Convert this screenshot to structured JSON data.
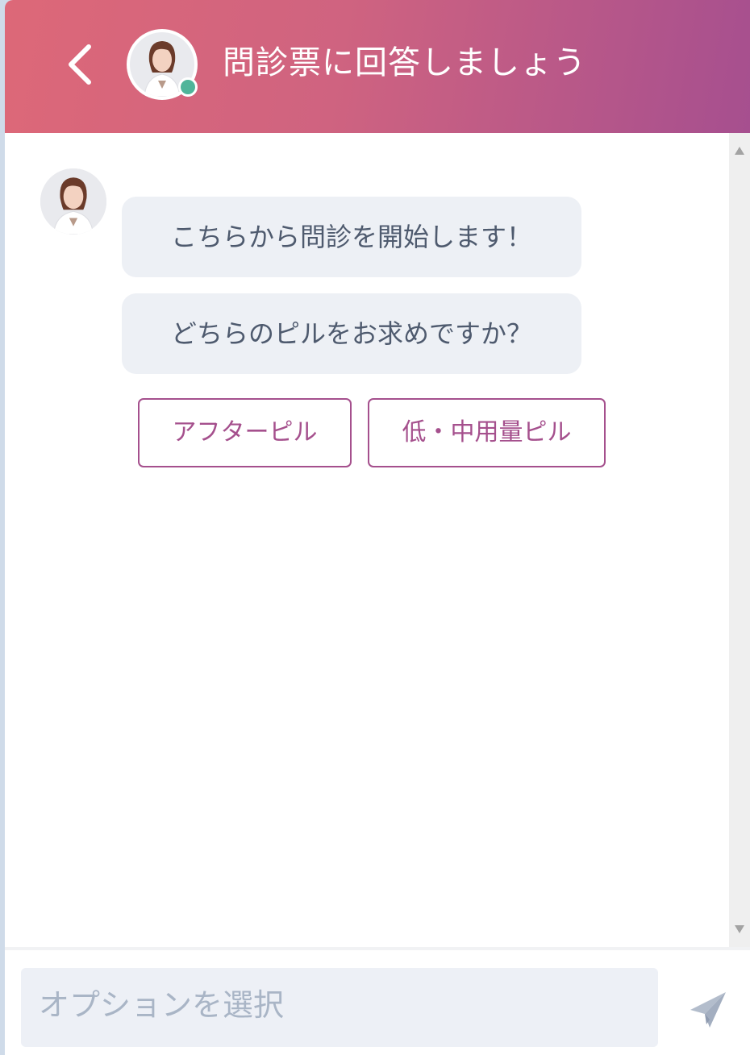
{
  "header": {
    "title": "問診票に回答しましょう",
    "gradient_start": "#dd6878",
    "gradient_end": "#a64f8f",
    "online_status_color": "#4fb59a"
  },
  "messages": [
    {
      "text": "こちらから問診を開始します！"
    },
    {
      "text": "どちらのピルをお求めですか？"
    }
  ],
  "options": [
    {
      "label": "アフターピル"
    },
    {
      "label": "低・中用量ピル"
    }
  ],
  "input": {
    "placeholder": "オプションを選択"
  },
  "icons": {
    "back": "chevron-left-icon",
    "send": "paper-plane-icon",
    "scroll_up": "triangle-up-icon",
    "scroll_down": "triangle-down-icon"
  },
  "colors": {
    "accent": "#a5508d",
    "bubble_bg": "#edf0f5",
    "bubble_text": "#4e5a6e"
  }
}
